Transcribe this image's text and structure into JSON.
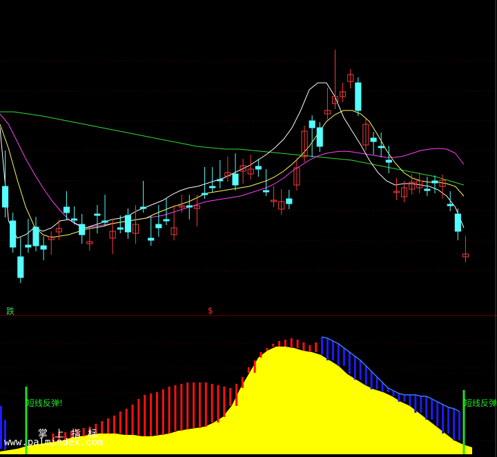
{
  "colors": {
    "background": "#000000",
    "candle_up": "#ff3b3b",
    "candle_down": "#54ffff",
    "ma_fast": "#ffffff",
    "ma_mid": "#ffff66",
    "ma_slow": "#ff44ff",
    "ma_long": "#33dd33",
    "bar_red": "#ff1010",
    "bar_blue": "#1c1cff",
    "fill_yellow": "#ffff00",
    "blue_line": "#3a7bff",
    "signal_green": "#22e022",
    "grid": "#3a0000"
  },
  "labels": {
    "top_signal": "跌",
    "dollar_mark": "$",
    "rebound_left": "短线反弹!",
    "rebound_right": "短线反弹",
    "watermark_cn": "掌上指标",
    "watermark_url": "www.palmindex.com"
  },
  "chart_data": [
    {
      "type": "candlestick",
      "series": [
        {
          "name": "price",
          "ohlc": [
            [
              270,
              300,
              226,
              307
            ],
            [
              320,
              358,
              356,
              316
            ],
            [
              372,
              402,
              352,
              402
            ],
            [
              355,
              358,
              325,
              342
            ],
            [
              329,
              356,
              349,
              322
            ],
            [
              356,
              361,
              369,
              350
            ],
            [
              347,
              343,
              361,
              345
            ],
            [
              336,
              331,
              340,
              326
            ],
            [
              300,
              308,
              285,
              310
            ],
            [
              317,
              317,
              317,
              307
            ],
            [
              325,
              340,
              345,
              318
            ],
            [
              353,
              350,
              355,
              340
            ],
            [
              310,
              312,
              330,
              305
            ],
            [
              320,
              320,
              310,
              290
            ],
            [
              345,
              335,
              360,
              325
            ],
            [
              330,
              330,
              330,
              320
            ],
            [
              312,
              336,
              338,
              310
            ],
            [
              338,
              325,
              345,
              305
            ],
            [
              300,
              300,
              270,
              285
            ],
            [
              345,
              348,
              348,
              320
            ],
            [
              325,
              330,
              335,
              305
            ],
            [
              318,
              318,
              318,
              295
            ],
            [
              340,
              330,
              335,
              305
            ],
            [
              300,
              298,
              300,
              290
            ],
            [
              298,
              300,
              310,
              290
            ],
            [
              302,
              298,
              320,
              290
            ],
            [
              280,
              280,
              250,
              268
            ],
            [
              270,
              270,
              250,
              260
            ],
            [
              260,
              262,
              240,
              265
            ],
            [
              255,
              250,
              250,
              235
            ],
            [
              252,
              268,
              250,
              230
            ],
            [
              248,
              240,
              258,
              238
            ],
            [
              252,
              245,
              247,
              232
            ],
            [
              241,
              245,
              248,
              238
            ],
            [
              276,
              276,
              268,
              253
            ],
            [
              292,
              290,
              283,
              277
            ],
            [
              303,
              292,
              303,
              282
            ],
            [
              288,
              295,
              285,
              283
            ],
            [
              268,
              243,
              241,
              237
            ],
            [
              227,
              190,
              217,
              193
            ],
            [
              175,
              185,
              220,
              180
            ],
            [
              185,
              212,
              192,
              195
            ],
            [
              165,
              160,
              135,
              150
            ],
            [
              150,
              140,
              80,
              142
            ],
            [
              140,
              133,
              138,
              128
            ],
            [
              118,
              108,
              120,
              108
            ],
            [
              120,
              160,
              130,
              160
            ],
            [
              210,
              180,
              200,
              195
            ],
            [
              200,
              205,
              216,
              199
            ],
            [
              212,
              213,
              220,
              200
            ],
            [
              232,
              235,
              243,
              219
            ],
            [
              278,
              277,
              282,
              266
            ],
            [
              285,
              272,
              285,
              270
            ],
            [
              274,
              264,
              271,
              260
            ],
            [
              272,
              262,
              264,
              258
            ],
            [
              274,
              276,
              268,
              264
            ],
            [
              262,
              265,
              264,
              272
            ],
            [
              270,
              261,
              280,
              262
            ],
            [
              296,
              298,
              298,
              285
            ],
            [
              310,
              335,
              320,
              340
            ],
            [
              372,
              368,
              366,
              350
            ]
          ]
        }
      ],
      "moving_averages": [
        {
          "name": "ma_fast",
          "values": [
            185,
            320,
            345,
            340,
            330,
            335,
            330,
            320,
            318,
            325,
            330,
            326,
            322,
            318,
            316,
            312,
            305,
            300,
            295,
            290,
            282,
            276,
            272,
            270,
            266,
            262,
            258,
            252,
            246,
            240,
            232,
            224,
            214,
            202,
            185,
            160,
            130,
            120,
            120,
            140,
            170,
            190,
            210,
            232,
            250,
            262,
            268,
            266,
            266,
            268,
            270,
            275,
            284,
            300,
            330
          ]
        },
        {
          "name": "ma_mid",
          "values": [
            180,
            215,
            260,
            300,
            328,
            340,
            344,
            342,
            340,
            336,
            332,
            330,
            328,
            324,
            322,
            320,
            318,
            316,
            310,
            305,
            300,
            296,
            292,
            286,
            280,
            278,
            276,
            274,
            272,
            270,
            266,
            262,
            256,
            248,
            238,
            226,
            212,
            194,
            176,
            166,
            160,
            160,
            165,
            176,
            196,
            218,
            236,
            250,
            258,
            262,
            264,
            264,
            266,
            270,
            284
          ]
        },
        {
          "name": "ma_slow",
          "values": [
            165,
            180,
            205,
            230,
            252,
            272,
            290,
            305,
            318,
            326,
            330,
            328,
            326,
            324,
            322,
            320,
            318,
            316,
            314,
            312,
            308,
            304,
            300,
            296,
            292,
            290,
            288,
            286,
            284,
            280,
            276,
            272,
            266,
            258,
            248,
            240,
            232,
            226,
            222,
            220,
            219,
            220,
            222,
            224,
            226,
            228,
            228,
            226,
            222,
            218,
            216,
            215,
            216,
            222,
            238
          ]
        },
        {
          "name": "ma_long",
          "values": [
            162,
            162,
            165,
            168,
            172,
            176,
            180,
            184,
            188,
            192,
            196,
            200,
            204,
            208,
            212,
            214,
            216,
            216,
            218,
            220,
            222,
            224,
            226,
            228,
            230,
            232,
            236,
            240,
            244,
            248,
            252,
            256,
            262,
            268
          ]
        }
      ],
      "ylim": [
        0,
        440
      ]
    },
    {
      "type": "bar",
      "series": [
        {
          "name": "red_bars",
          "values": [
            0,
            0,
            0,
            0,
            30,
            32,
            32,
            34,
            36,
            38,
            40,
            44,
            48,
            52,
            56,
            62,
            66,
            72,
            80,
            86,
            88,
            90,
            94,
            98,
            100,
            102,
            104,
            104,
            104,
            104,
            102,
            100,
            98,
            96,
            102,
            112,
            126,
            136,
            148,
            154,
            160,
            164,
            166,
            168,
            166,
            162,
            158,
            162
          ]
        },
        {
          "name": "blue_bars",
          "values": [
            170,
            168,
            164,
            160,
            154,
            148,
            142,
            136,
            128,
            120,
            112,
            104,
            96,
            92,
            88,
            86,
            86,
            86,
            84,
            84,
            80,
            76,
            72,
            68,
            66,
            62
          ]
        },
        {
          "name": "yellow_fill",
          "values": [
            4,
            6,
            8,
            12,
            14,
            16,
            18,
            20,
            24,
            26,
            28,
            30,
            30,
            30,
            28,
            28,
            26,
            26,
            28,
            30,
            34,
            36,
            38,
            40,
            46,
            54,
            70,
            96,
            118,
            140,
            150,
            156,
            156,
            154,
            150,
            148,
            144,
            136,
            128,
            116,
            108,
            100,
            94,
            90,
            84,
            76,
            70,
            60,
            50,
            40,
            30,
            20,
            14,
            10
          ]
        }
      ],
      "ylim": [
        0,
        200
      ]
    }
  ]
}
